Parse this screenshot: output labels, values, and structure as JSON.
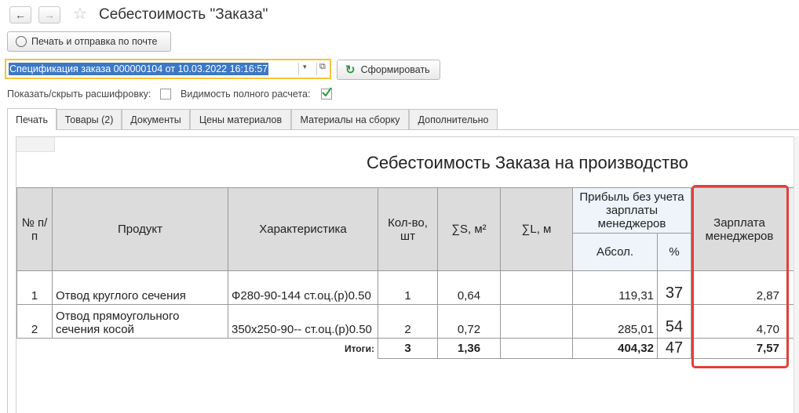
{
  "window": {
    "title": "Себестоимость \"Заказа\""
  },
  "toolbar": {
    "print_send_label": "Печать и отправка по почте"
  },
  "selector": {
    "value": "Спецификация заказа 000000104 от 10.03.2022 16:16:57",
    "generate_label": "Сформировать"
  },
  "options": {
    "toggle_details_label": "Показать/скрыть расшифровку:",
    "full_calc_label": "Видимость полного расчета:"
  },
  "tabs": [
    {
      "label": "Печать"
    },
    {
      "label": "Товары (2)"
    },
    {
      "label": "Документы"
    },
    {
      "label": "Цены материалов"
    },
    {
      "label": "Материалы на сборку"
    },
    {
      "label": "Дополнительно"
    }
  ],
  "report": {
    "title": "Себестоимость Заказа на производство",
    "headers": {
      "num": "№ п/п",
      "product": "Продукт",
      "characteristic": "Характеристика",
      "qty": "Кол-во, шт",
      "area": "∑S, м²",
      "length": "∑L, м",
      "profit": "Прибыль без учета зарплаты менеджеров",
      "abs": "Абсол.",
      "pct": "%",
      "salary": "Зарплата менеджеров"
    },
    "rows": [
      {
        "num": "1",
        "product": "Отвод круглого сечения",
        "characteristic": "Ф280-90-144 ст.оц.(р)0.50",
        "qty": "1",
        "area": "0,64",
        "length": "",
        "abs": "119,31",
        "pct": "37",
        "salary": "2,87"
      },
      {
        "num": "2",
        "product": "Отвод прямоугольного сечения косой",
        "characteristic": "350x250-90-- ст.оц.(р)0.50",
        "qty": "2",
        "area": "0,72",
        "length": "",
        "abs": "285,01",
        "pct": "54",
        "salary": "4,70"
      }
    ],
    "totals": {
      "label": "Итоги:",
      "qty": "3",
      "area": "1,36",
      "length": "",
      "abs": "404,32",
      "pct": "47",
      "salary": "7,57"
    }
  },
  "colors": {
    "highlight_border": "#e0403a",
    "selection": "#3c78c6",
    "combo_border": "#f2c43d",
    "check": "#2e9a3e"
  }
}
